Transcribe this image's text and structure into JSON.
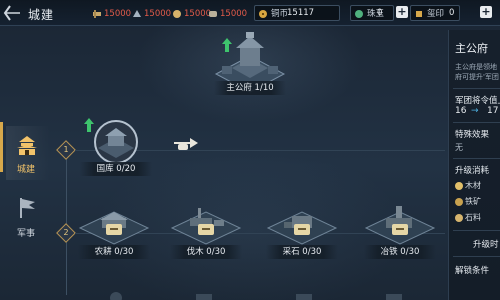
{
  "page": {
    "title": "城建"
  },
  "resources": [
    {
      "name": "wood",
      "icon": "wood-icon",
      "value": "15000"
    },
    {
      "name": "iron",
      "icon": "iron-icon",
      "value": "15000"
    },
    {
      "name": "grain",
      "icon": "grain-icon",
      "value": "15000"
    },
    {
      "name": "stone",
      "icon": "stone-icon",
      "value": "15000"
    }
  ],
  "currencies": [
    {
      "label": "铜币",
      "value": "15117"
    },
    {
      "label": "珠玉",
      "value": "0"
    },
    {
      "label": "玺印",
      "value": "0"
    }
  ],
  "nav": {
    "items": [
      {
        "label": "城建",
        "icon": "city-icon",
        "active": true
      },
      {
        "label": "军事",
        "icon": "flag-icon",
        "active": false
      }
    ]
  },
  "tree": {
    "rows": [
      "1",
      "2"
    ],
    "buildings": {
      "main": {
        "label": "主公府 1/10"
      },
      "treasury": {
        "label": "国库 0/20"
      },
      "farm": {
        "label": "农耕 0/30"
      },
      "lumber": {
        "label": "伐木 0/30"
      },
      "quarry": {
        "label": "采石 0/30"
      },
      "smelting": {
        "label": "冶铁 0/30"
      }
    }
  },
  "panel": {
    "title": "主公府",
    "desc_line1": "主公府是领地",
    "desc_line2": "府可提升'军团",
    "command_label": "军团将令值上",
    "command_from": "16",
    "command_to": "17",
    "arrow": "→",
    "effect_label": "特殊效果",
    "effect_value": "无",
    "cost_label": "升级消耗",
    "costs": [
      "木材",
      "铁矿",
      "石料"
    ],
    "time_label": "升级时",
    "unlock_label": "解锁条件"
  },
  "colors": {
    "accent": "#d7a84b",
    "resource_text": "#e25b4a",
    "arrow_blue": "#4fb0e0",
    "upgrade_green": "#3ec46d"
  }
}
